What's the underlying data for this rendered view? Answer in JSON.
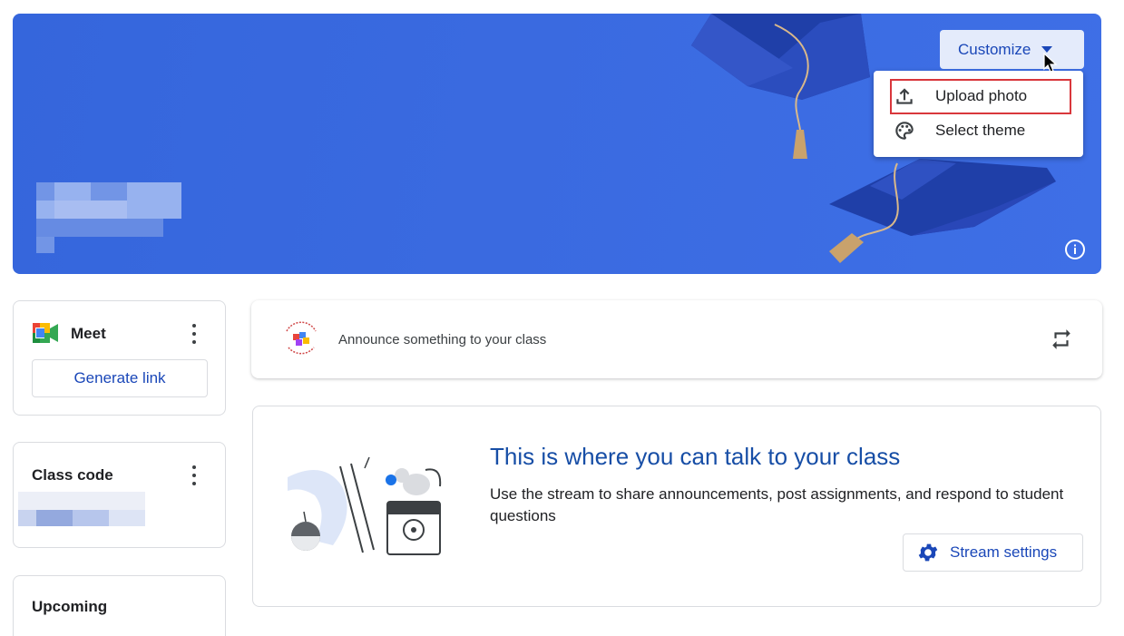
{
  "banner": {
    "customize_label": "Customize",
    "menu": [
      {
        "label": "Upload photo",
        "icon": "upload-icon",
        "highlighted": true
      },
      {
        "label": "Select theme",
        "icon": "palette-icon"
      }
    ],
    "info_icon": "info-icon",
    "background_color": "#3a6ae0"
  },
  "meet": {
    "title": "Meet",
    "generate_label": "Generate link"
  },
  "class_code": {
    "title": "Class code"
  },
  "upcoming": {
    "title": "Upcoming"
  },
  "announce": {
    "placeholder": "Announce something to your class",
    "repost_icon": "repost-icon"
  },
  "stream": {
    "title": "This is where you can talk to your class",
    "description": "Use the stream to share announcements, post assignments, and respond to student questions",
    "settings_label": "Stream settings"
  },
  "colors": {
    "accent": "#1a47b8",
    "highlight_border": "#d9373c"
  }
}
